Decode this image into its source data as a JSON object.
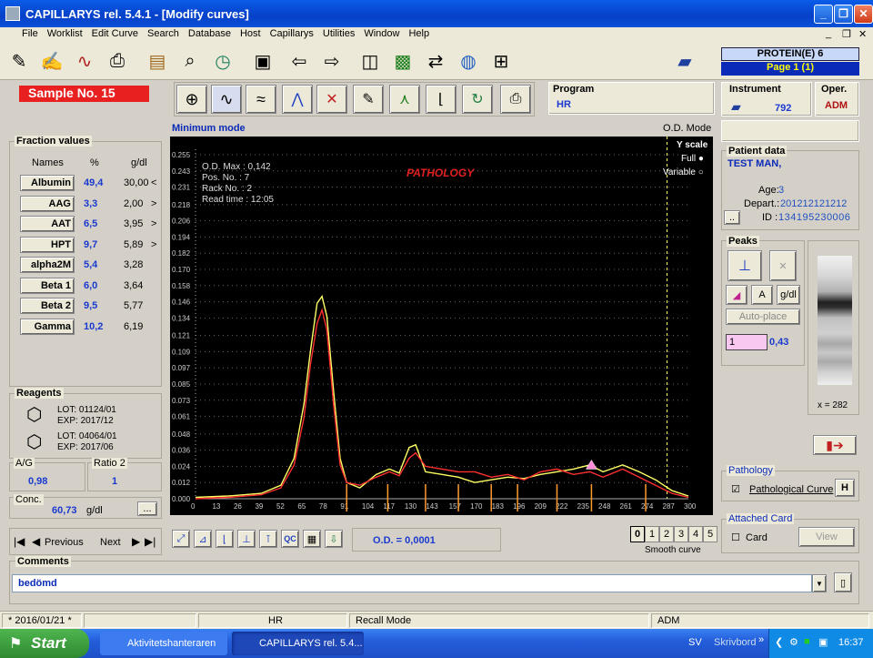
{
  "window": {
    "title": "CAPILLARYS rel. 5.4.1 - [Modify curves]",
    "minimize": "_",
    "maximize": "❐",
    "close": "✕"
  },
  "menu": [
    "File",
    "Worklist",
    "Edit Curve",
    "Search",
    "Database",
    "Host",
    "Capillarys",
    "Utilities",
    "Window",
    "Help"
  ],
  "mdi_controls": {
    "min": "_",
    "restore": "❐",
    "close": "✕"
  },
  "header_right": {
    "protein": "PROTEIN(E) 6",
    "page": "Page 1 (1)"
  },
  "sample": {
    "label": "Sample No. 15"
  },
  "mode": {
    "left": "Minimum mode",
    "right": "O.D. Mode"
  },
  "program": {
    "title": "Program",
    "value": "HR"
  },
  "instrument": {
    "title": "Instrument",
    "value": "792"
  },
  "operator": {
    "title": "Oper.",
    "value": "ADM"
  },
  "fractions": {
    "title": "Fraction values",
    "col_names": "Names",
    "col_pct": "%",
    "col_gdl": "g/dl",
    "rows": [
      {
        "name": "Albumin",
        "pct": "49,4",
        "gdl": "30,00",
        "flag": "<"
      },
      {
        "name": "AAG",
        "pct": "3,3",
        "gdl": "2,00",
        "flag": ">"
      },
      {
        "name": "AAT",
        "pct": "6,5",
        "gdl": "3,95",
        "flag": ">"
      },
      {
        "name": "HPT",
        "pct": "9,7",
        "gdl": "5,89",
        "flag": ">"
      },
      {
        "name": "alpha2M",
        "pct": "5,4",
        "gdl": "3,28",
        "flag": ""
      },
      {
        "name": "Beta 1",
        "pct": "6,0",
        "gdl": "3,64",
        "flag": ""
      },
      {
        "name": "Beta 2",
        "pct": "9,5",
        "gdl": "5,77",
        "flag": ""
      },
      {
        "name": "Gamma",
        "pct": "10,2",
        "gdl": "6,19",
        "flag": ""
      }
    ]
  },
  "reagents": {
    "title": "Reagents",
    "lot1": "LOT: 01124/01",
    "exp1": "EXP: 2017/12",
    "lot2": "LOT: 04064/01",
    "exp2": "EXP: 2017/06"
  },
  "ag": {
    "title": "A/G",
    "value": "0,98"
  },
  "ratio2": {
    "title": "Ratio 2",
    "value": "1"
  },
  "conc": {
    "title": "Conc.",
    "value": "60,73",
    "unit": "g/dl",
    "btn": "..."
  },
  "chart_info": {
    "odmax": "O.D. Max : 0,142",
    "pos": "Pos. No.  : 7",
    "rack": "Rack No.  : 2",
    "read": "Read time : 12:05",
    "pathology": "PATHOLOGY",
    "yscale": "Y scale",
    "full": "Full",
    "variable": "Variable"
  },
  "chart_data": {
    "type": "line",
    "y_ticks": [
      "0.255",
      "0.243",
      "0.231",
      "0.218",
      "0.206",
      "0.194",
      "0.182",
      "0.170",
      "0.158",
      "0.146",
      "0.134",
      "0.121",
      "0.109",
      "0.097",
      "0.085",
      "0.073",
      "0.061",
      "0.048",
      "0.036",
      "0.024",
      "0.012",
      "0.000"
    ],
    "x_ticks": [
      "0",
      "13",
      "26",
      "39",
      "52",
      "65",
      "78",
      "91",
      "104",
      "117",
      "130",
      "143",
      "157",
      "170",
      "183",
      "196",
      "209",
      "222",
      "235",
      "248",
      "261",
      "274",
      "287",
      "300"
    ],
    "ylim": [
      0,
      0.255
    ],
    "xlim": [
      0,
      300
    ],
    "series": [
      {
        "color": "#ffff66",
        "points": [
          [
            0,
            0.001
          ],
          [
            20,
            0.002
          ],
          [
            40,
            0.004
          ],
          [
            52,
            0.01
          ],
          [
            60,
            0.03
          ],
          [
            66,
            0.07
          ],
          [
            70,
            0.11
          ],
          [
            74,
            0.145
          ],
          [
            77,
            0.15
          ],
          [
            80,
            0.135
          ],
          [
            84,
            0.08
          ],
          [
            88,
            0.03
          ],
          [
            92,
            0.012
          ],
          [
            100,
            0.008
          ],
          [
            110,
            0.018
          ],
          [
            118,
            0.022
          ],
          [
            124,
            0.019
          ],
          [
            130,
            0.038
          ],
          [
            134,
            0.04
          ],
          [
            140,
            0.02
          ],
          [
            150,
            0.018
          ],
          [
            160,
            0.016
          ],
          [
            170,
            0.012
          ],
          [
            180,
            0.014
          ],
          [
            190,
            0.016
          ],
          [
            200,
            0.015
          ],
          [
            210,
            0.018
          ],
          [
            220,
            0.02
          ],
          [
            230,
            0.022
          ],
          [
            240,
            0.025
          ],
          [
            248,
            0.02
          ],
          [
            260,
            0.025
          ],
          [
            270,
            0.02
          ],
          [
            280,
            0.014
          ],
          [
            290,
            0.006
          ],
          [
            300,
            0.002
          ]
        ]
      },
      {
        "color": "#ff3030",
        "points": [
          [
            0,
            0.0
          ],
          [
            20,
            0.001
          ],
          [
            40,
            0.003
          ],
          [
            52,
            0.008
          ],
          [
            60,
            0.025
          ],
          [
            66,
            0.06
          ],
          [
            70,
            0.1
          ],
          [
            74,
            0.13
          ],
          [
            77,
            0.14
          ],
          [
            80,
            0.125
          ],
          [
            84,
            0.07
          ],
          [
            88,
            0.025
          ],
          [
            92,
            0.012
          ],
          [
            100,
            0.01
          ],
          [
            110,
            0.016
          ],
          [
            118,
            0.02
          ],
          [
            124,
            0.017
          ],
          [
            130,
            0.03
          ],
          [
            134,
            0.034
          ],
          [
            140,
            0.024
          ],
          [
            150,
            0.022
          ],
          [
            160,
            0.02
          ],
          [
            170,
            0.02
          ],
          [
            180,
            0.016
          ],
          [
            190,
            0.018
          ],
          [
            200,
            0.014
          ],
          [
            210,
            0.02
          ],
          [
            220,
            0.022
          ],
          [
            230,
            0.018
          ],
          [
            240,
            0.02
          ],
          [
            248,
            0.016
          ],
          [
            260,
            0.022
          ],
          [
            270,
            0.016
          ],
          [
            280,
            0.01
          ],
          [
            290,
            0.004
          ],
          [
            300,
            0.001
          ]
        ]
      }
    ],
    "separators": [
      92,
      117,
      140,
      160,
      180,
      196,
      220,
      241,
      274
    ],
    "dashed_marker": 287
  },
  "nav": {
    "previous": "Previous",
    "next": "Next"
  },
  "od": {
    "label": "O.D. = 0,0001"
  },
  "smooth": {
    "options": [
      "0",
      "1",
      "2",
      "3",
      "4",
      "5"
    ],
    "label": "Smooth curve"
  },
  "patient": {
    "title": "Patient data",
    "name": "TEST MAN,",
    "age_label": "Age:",
    "age": "3",
    "depart_label": "Depart.:",
    "depart": "201212121212",
    "id_label": "ID :",
    "id": "134195230006",
    "btn": ".."
  },
  "peaks": {
    "title": "Peaks",
    "a": "A",
    "gdl": "g/dl",
    "autoplace": "Auto-place",
    "field": "1",
    "value": "0,43"
  },
  "gel": {
    "x_label": "x = 282"
  },
  "pathology_box": {
    "title": "Pathology",
    "check": "Pathological Curve",
    "h": "H"
  },
  "attached": {
    "title": "Attached Card",
    "card": "Card",
    "view": "View"
  },
  "comments": {
    "title": "Comments",
    "value": "bedömd"
  },
  "status": {
    "date": "* 2016/01/21 *",
    "c2": "",
    "prog": "HR",
    "mode": "Recall Mode",
    "user": "ADM"
  },
  "taskbar": {
    "start": "Start",
    "task1": "Aktivitetshanteraren",
    "task2": "CAPILLARYS rel. 5.4...",
    "lang": "SV",
    "desk": "Skrivbord",
    "clock": "16:37"
  }
}
